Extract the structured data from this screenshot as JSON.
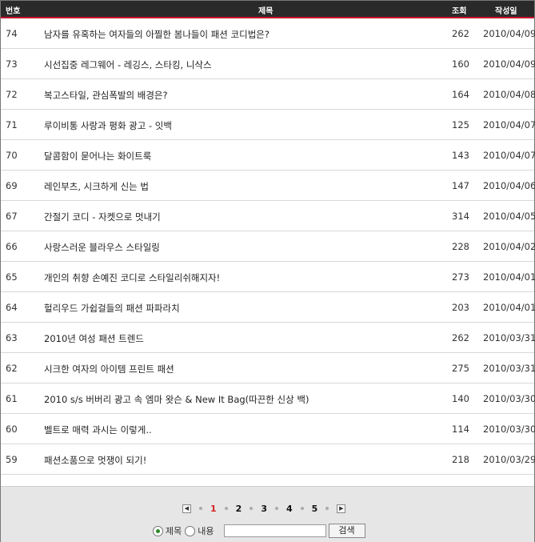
{
  "header": {
    "no": "번호",
    "title": "제목",
    "views": "조회",
    "date": "작성일"
  },
  "posts": [
    {
      "no": "74",
      "title": "남자를 유혹하는 여자들의 아찔한 봄나들이 패션 코디법은?",
      "views": "262",
      "date": "2010/04/09"
    },
    {
      "no": "73",
      "title": "시선집중 레그웨어 - 레깅스, 스타킹, 니삭스",
      "views": "160",
      "date": "2010/04/09"
    },
    {
      "no": "72",
      "title": "복고스타일, 관심폭발의 배경은?",
      "views": "164",
      "date": "2010/04/08"
    },
    {
      "no": "71",
      "title": "루이비통 사랑과 평화 광고 - 잇백",
      "views": "125",
      "date": "2010/04/07"
    },
    {
      "no": "70",
      "title": "달콤함이 묻어나는 화이트룩",
      "views": "143",
      "date": "2010/04/07"
    },
    {
      "no": "69",
      "title": "레인부츠, 시크하게 신는 법",
      "views": "147",
      "date": "2010/04/06"
    },
    {
      "no": "67",
      "title": "간절기 코디 - 자켓으로 멋내기",
      "views": "314",
      "date": "2010/04/05"
    },
    {
      "no": "66",
      "title": "사랑스러운 블라우스 스타일링",
      "views": "228",
      "date": "2010/04/02"
    },
    {
      "no": "65",
      "title": "개인의 취향 손예진 코디로 스타일리쉬해지자!",
      "views": "273",
      "date": "2010/04/01"
    },
    {
      "no": "64",
      "title": "헐리우드 가쉽걸들의 패션 파파라치",
      "views": "203",
      "date": "2010/04/01"
    },
    {
      "no": "63",
      "title": "2010년 여성 패션 트렌드",
      "views": "262",
      "date": "2010/03/31"
    },
    {
      "no": "62",
      "title": "시크한 여자의 아이템 프린트 패션",
      "views": "275",
      "date": "2010/03/31"
    },
    {
      "no": "61",
      "title": "2010 s/s 버버리 광고 속 엠마 왓슨 & New It Bag(따끈한 신상 백)",
      "views": "140",
      "date": "2010/03/30"
    },
    {
      "no": "60",
      "title": "벨트로 매력 과시는 이렇게..",
      "views": "114",
      "date": "2010/03/30"
    },
    {
      "no": "59",
      "title": "패션소품으로 멋쟁이 되기!",
      "views": "218",
      "date": "2010/03/29"
    }
  ],
  "pagination": {
    "pages": [
      "1",
      "2",
      "3",
      "4",
      "5"
    ],
    "current": "1",
    "prev_icon": "left-arrow-icon",
    "next_icon": "right-arrow-icon"
  },
  "search": {
    "option_title": "제목",
    "option_content": "내용",
    "selected": "제목",
    "value": "",
    "button_label": "검색"
  },
  "colors": {
    "header_bg": "#2a2a2a",
    "header_accent": "#c4122c",
    "active_page": "#d12222"
  }
}
